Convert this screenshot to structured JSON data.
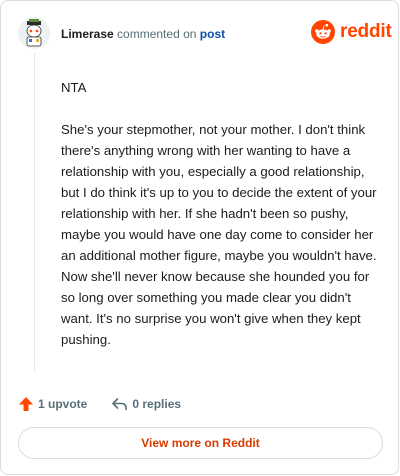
{
  "header": {
    "author": "Limerase",
    "action": "commented on",
    "target": "post",
    "brand": "reddit"
  },
  "comment": {
    "paragraphs": [
      "NTA",
      "She's your stepmother, not your mother. I don't think there's anything wrong with her wanting to have a relationship with you, especially a good relationship, but I do think it's up to you to decide the extent of your relationship with her. If she hadn't been so pushy, maybe you would have one day come to consider her an additional mother figure, maybe you wouldn't have. Now she'll never know because she hounded you for so long over something you made clear you didn't want. It's no surprise you won't give when they kept pushing."
    ]
  },
  "meta": {
    "upvotes": "1 upvote",
    "replies": "0 replies"
  },
  "footer": {
    "view_more": "View more on Reddit"
  },
  "colors": {
    "brand": "#ff4500",
    "upvote": "#ff4500",
    "link": "#0b4fa8",
    "muted": "#576f76"
  },
  "icons": {
    "avatar": "user-avatar",
    "brand": "reddit-logo-icon",
    "upvote": "upvote-arrow-icon",
    "reply": "reply-arrow-icon"
  }
}
